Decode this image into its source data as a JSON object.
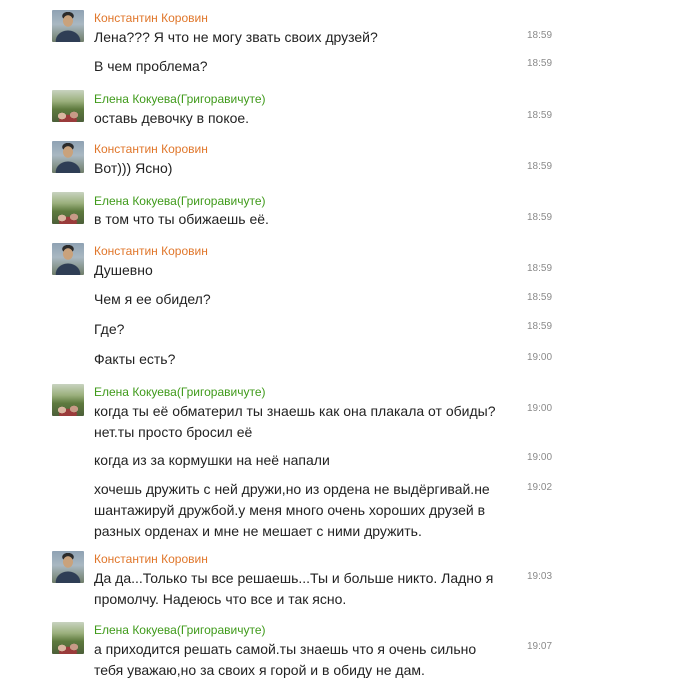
{
  "participants": {
    "konstantin": {
      "name": "Константин Коровин",
      "color": "#e0762a"
    },
    "elena": {
      "name": "Елена Кокуева(Григоравичуте)",
      "color": "#3f9a1a"
    }
  },
  "messages": [
    {
      "text": "Лена??? Я что не могу звать своих друзей?",
      "time": "18:59"
    },
    {
      "text": "В чем проблема?",
      "time": "18:59"
    },
    {
      "text": "оставь девочку в покое.",
      "time": "18:59"
    },
    {
      "text": "Вот))) Ясно)",
      "time": "18:59"
    },
    {
      "text": "в том что ты обижаешь её.",
      "time": "18:59"
    },
    {
      "text": "Душевно",
      "time": "18:59"
    },
    {
      "text": "Чем я ее обидел?",
      "time": "18:59"
    },
    {
      "text": "Где?",
      "time": "18:59"
    },
    {
      "text": "Факты есть?",
      "time": "19:00"
    },
    {
      "text": "когда ты её обматерил ты знаешь как она плакала от обиды?нет.ты просто бросил её",
      "time": "19:00"
    },
    {
      "text": "когда из за кормушки на неё напали",
      "time": "19:00"
    },
    {
      "text": "хочешь дружить с ней дружи,но из ордена не выдёргивай.не шантажируй дружбой.у меня много очень хороших друзей в разных орденах и мне не мешает с ними дружить.",
      "time": "19:02"
    },
    {
      "text": "Да да...Только ты все решаешь...Ты и больше никто. Ладно я промолчу. Надеюсь что все и так ясно.",
      "time": "19:03"
    },
    {
      "text": "а приходится решать самой.ты знаешь что я очень сильно тебя уважаю,но за своих я горой и в обиду не дам.",
      "time": "19:07"
    }
  ]
}
